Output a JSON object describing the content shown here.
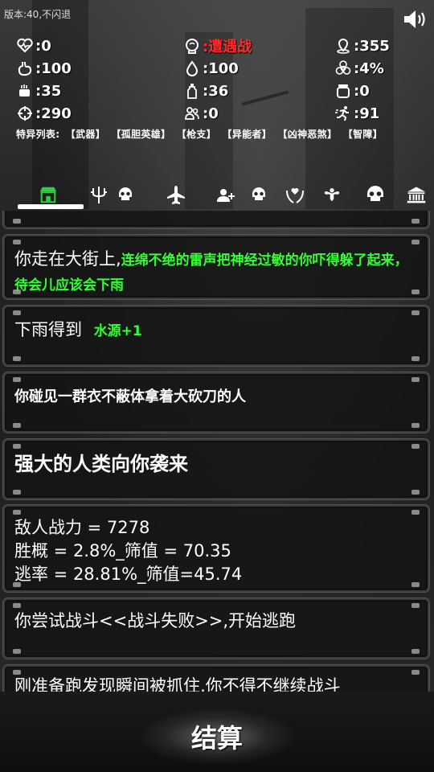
{
  "version_label": "版本:40,不闪退",
  "stats": {
    "health": ":0",
    "encounter": ":遭遇战",
    "location": ":355",
    "hunger": ":100",
    "water": ":100",
    "infection": ":4%",
    "food": ":35",
    "drink": ":36",
    "bag": ":0",
    "attack": ":290",
    "companions": ":0",
    "speed": ":91"
  },
  "traits": {
    "label": "特异列表:",
    "items": [
      "【武器】",
      "【孤胆英雄】",
      "【枪支】",
      "【异能者】",
      "【凶神恶煞】",
      "【智障】"
    ]
  },
  "tabs": [
    "shop",
    "trident",
    "skull",
    "plane",
    "add-user",
    "skull",
    "heart-hands",
    "muscle",
    "skull",
    "bank"
  ],
  "log": {
    "entry1_white": "你走在大街上,",
    "entry1_green": "连绵不绝的雷声把神经过敏的你吓得躲了起来，待会儿应该会下雨",
    "entry2_white": "下雨得到",
    "entry2_green": "水源+1",
    "entry3": "你碰见一群衣不蔽体拿着大砍刀的人",
    "entry4": "强大的人类向你袭来",
    "entry5_l1": "敌人战力 = 7278",
    "entry5_l2": "胜概 = 2.8%_筛值 = 70.35",
    "entry5_l3": "逃率 = 28.81%_筛值=45.74",
    "entry6": "你尝试战斗<<战斗失败>>,开始逃跑",
    "entry7": "刚准备跑发现瞬间被抓住,你不得不继续战斗"
  },
  "settle_button": "结算"
}
